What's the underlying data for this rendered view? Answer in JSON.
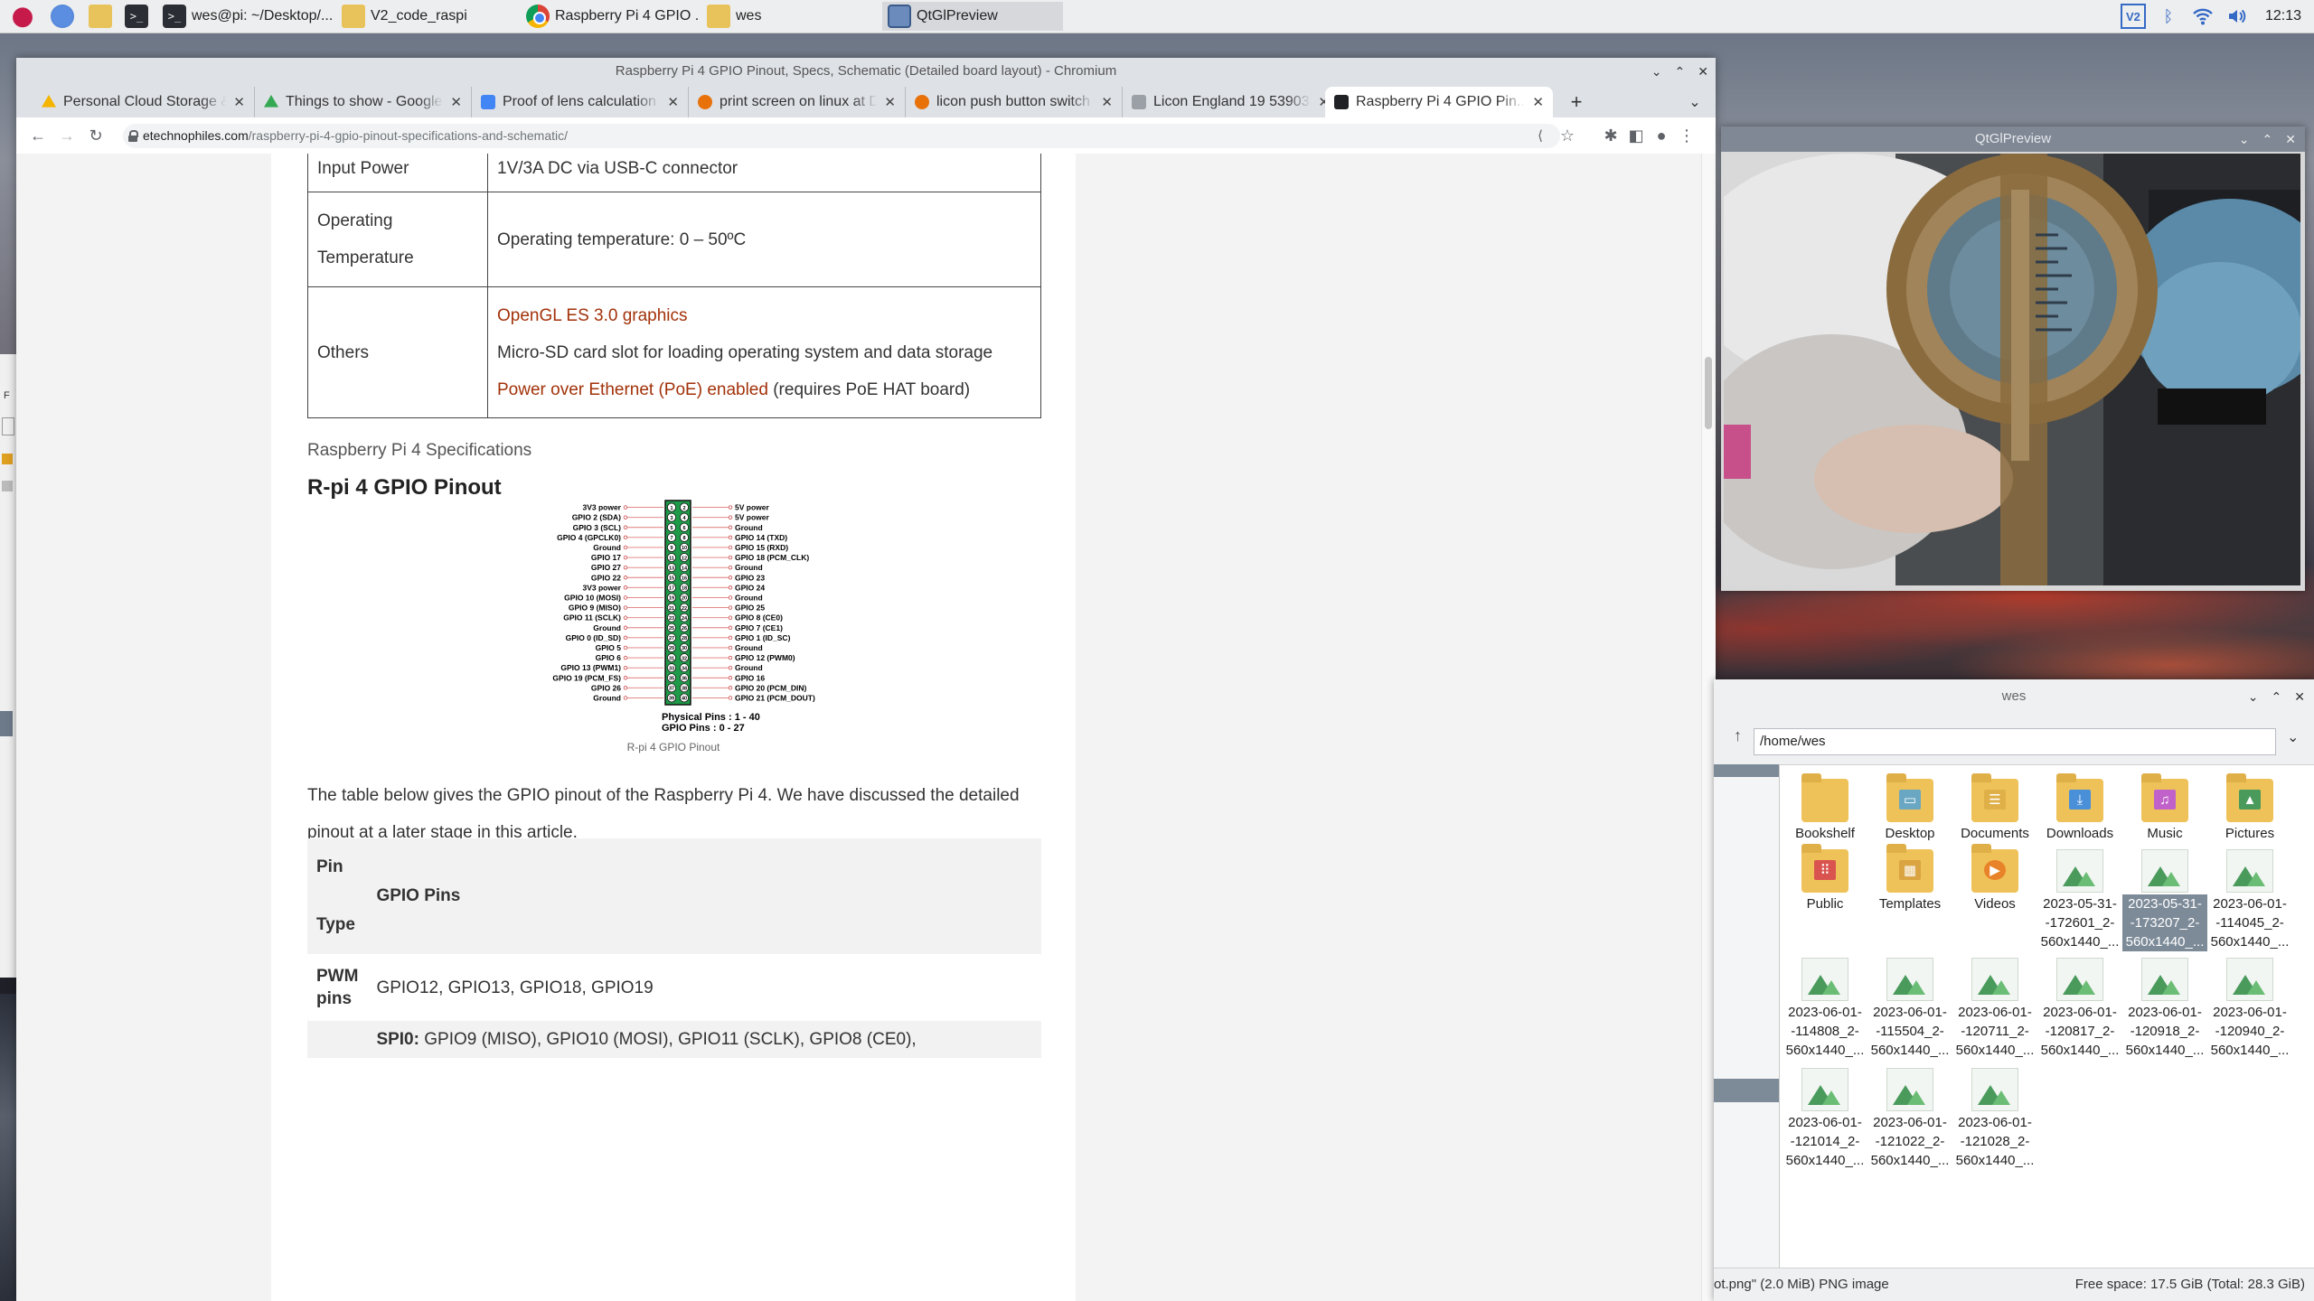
{
  "taskbar": {
    "items": [
      {
        "label": "",
        "icon": "raspberry-menu-icon"
      },
      {
        "label": "",
        "icon": "web-browser-icon"
      },
      {
        "label": "",
        "icon": "file-manager-icon"
      },
      {
        "label": "",
        "icon": "terminal-icon"
      },
      {
        "label": "wes@pi: ~/Desktop/...",
        "icon": "terminal-icon"
      },
      {
        "label": "V2_code_raspi",
        "icon": "folder-icon"
      },
      {
        "label": "Raspberry Pi 4 GPIO ...",
        "icon": "chromium-icon"
      },
      {
        "label": "wes",
        "icon": "folder-icon"
      },
      {
        "label": "QtGlPreview",
        "icon": "window-icon"
      }
    ],
    "tray": {
      "vnc": "V2",
      "clock": "12:13"
    }
  },
  "browser": {
    "window_title": "Raspberry Pi 4 GPIO Pinout, Specs, Schematic (Detailed board layout) - Chromium",
    "tabs": [
      {
        "label": "Personal Cloud Storage & ...",
        "favicon_color": "#f4b400"
      },
      {
        "label": "Things to show - Google ...",
        "favicon_color": "#34a853"
      },
      {
        "label": "Proof of lens calculation ...",
        "favicon_color": "#4285f4"
      },
      {
        "label": "print screen on linux at D...",
        "favicon_color": "#e8710a"
      },
      {
        "label": "licon push button switch ...",
        "favicon_color": "#e8710a"
      },
      {
        "label": "Licon England 19 53903 ...",
        "favicon_color": "#9aa0a6"
      },
      {
        "label": "Raspberry Pi 4 GPIO Pin...",
        "favicon_color": "#202124"
      }
    ],
    "new_tab": "+",
    "url_domain": "etechnophiles.com",
    "url_path": "/raspberry-pi-4-gpio-pinout-specifications-and-schematic/",
    "page": {
      "spec_table": [
        {
          "key": "Input Power",
          "lines": [
            {
              "text": "1V/3A DC via USB-C connector"
            }
          ]
        },
        {
          "key": "Operating Temperature",
          "lines": [
            {
              "text": "Operating temperature: 0 – 50ºC"
            }
          ]
        },
        {
          "key": "Others",
          "lines": [
            {
              "text": "OpenGL ES 3.0 graphics",
              "link": true
            },
            {
              "text": "Micro-SD card slot for loading operating system and data storage"
            },
            {
              "text": "Power over Ethernet (PoE) enabled",
              "link": true,
              "suffix": " (requires PoE HAT board)"
            }
          ]
        }
      ],
      "spec_caption": "Raspberry Pi 4 Specifications",
      "heading": "R-pi 4 GPIO Pinout",
      "pinout": {
        "left": [
          "3V3 power",
          "GPIO 2 (SDA)",
          "GPIO 3 (SCL)",
          "GPIO 4 (GPCLK0)",
          "Ground",
          "GPIO 17",
          "GPIO 27",
          "GPIO 22",
          "3V3 power",
          "GPIO 10 (MOSI)",
          "GPIO 9 (MISO)",
          "GPIO 11 (SCLK)",
          "Ground",
          "GPIO 0 (ID_SD)",
          "GPIO 5",
          "GPIO 6",
          "GPIO 13 (PWM1)",
          "GPIO 19 (PCM_FS)",
          "GPIO 26",
          "Ground"
        ],
        "right": [
          "5V power",
          "5V power",
          "Ground",
          "GPIO 14 (TXD)",
          "GPIO 15 (RXD)",
          "GPIO 18 (PCM_CLK)",
          "Ground",
          "GPIO 23",
          "GPIO 24",
          "Ground",
          "GPIO 25",
          "GPIO 8 (CE0)",
          "GPIO 7 (CE1)",
          "GPIO 1 (ID_SC)",
          "Ground",
          "GPIO 12 (PWM0)",
          "Ground",
          "GPIO 16",
          "GPIO 20 (PCM_DIN)",
          "GPIO 21 (PCM_DOUT)"
        ],
        "legend_physical": "Physical Pins : 1 - 40",
        "legend_gpio": "GPIO Pins : 0 - 27"
      },
      "pinout_caption": "R-pi 4 GPIO Pinout",
      "paragraph": "The table below gives the GPIO pinout of the Raspberry Pi 4. We have discussed the detailed pinout at a later stage in this article.",
      "gpio_table": {
        "headers": [
          "Pin Type",
          "GPIO Pins"
        ],
        "rows": [
          {
            "type": "PWM pins",
            "pins": "GPIO12, GPIO13, GPIO18, GPIO19"
          },
          {
            "type": "",
            "pins_bold": "SPI0:",
            "pins": " GPIO9 (MISO), GPIO10 (MOSI), GPIO11 (SCLK), GPIO8 (CE0),"
          }
        ]
      }
    }
  },
  "qt_preview": {
    "title": "QtGlPreview"
  },
  "file_manager": {
    "title": "wes",
    "path": "/home/wes",
    "items": [
      {
        "name": "Bookshelf",
        "kind": "folder"
      },
      {
        "name": "Desktop",
        "kind": "folder",
        "glyph": "▭"
      },
      {
        "name": "Documents",
        "kind": "folder",
        "glyph": "☰"
      },
      {
        "name": "Downloads",
        "kind": "folder",
        "glyph": "⤓"
      },
      {
        "name": "Music",
        "kind": "folder",
        "glyph": "♫"
      },
      {
        "name": "Pictures",
        "kind": "folder",
        "glyph": "▲"
      },
      {
        "name": "Public",
        "kind": "folder",
        "glyph": "⠿"
      },
      {
        "name": "Templates",
        "kind": "folder",
        "glyph": "▦"
      },
      {
        "name": "Videos",
        "kind": "folder",
        "glyph": "▶"
      },
      {
        "name": "2023-05-31--172601_2-560x1440_...",
        "kind": "image"
      },
      {
        "name": "2023-05-31--173207_2-560x1440_...",
        "kind": "image",
        "selected": true
      },
      {
        "name": "2023-06-01--114045_2-560x1440_...",
        "kind": "image"
      },
      {
        "name": "2023-06-01--114808_2-560x1440_...",
        "kind": "image"
      },
      {
        "name": "2023-06-01--115504_2-560x1440_...",
        "kind": "image"
      },
      {
        "name": "2023-06-01--120711_2-560x1440_...",
        "kind": "image"
      },
      {
        "name": "2023-06-01--120817_2-560x1440_...",
        "kind": "image"
      },
      {
        "name": "2023-06-01--120918_2-560x1440_...",
        "kind": "image"
      },
      {
        "name": "2023-06-01--120940_2-560x1440_...",
        "kind": "image"
      },
      {
        "name": "2023-06-01--121014_2-560x1440_...",
        "kind": "image"
      },
      {
        "name": "2023-06-01--121022_2-560x1440_...",
        "kind": "image"
      },
      {
        "name": "2023-06-01--121028_2-560x1440_...",
        "kind": "image"
      }
    ],
    "status_left": "ot.png\" (2.0 MiB) PNG image",
    "status_right": "Free space: 17.5 GiB (Total: 28.3 GiB)"
  }
}
